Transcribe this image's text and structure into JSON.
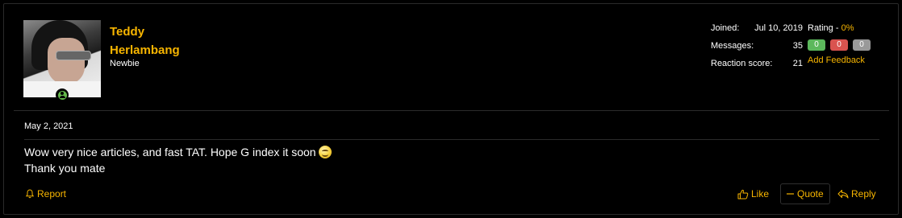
{
  "user": {
    "name": "Teddy Herlambang",
    "title": "Newbie"
  },
  "stats": {
    "joined_label": "Joined:",
    "joined_value": "Jul 10, 2019",
    "messages_label": "Messages:",
    "messages_value": "35",
    "reaction_label": "Reaction score:",
    "reaction_value": "21"
  },
  "rating": {
    "label": "Rating - ",
    "percent": "0%",
    "positive": "0",
    "negative": "0",
    "neutral": "0",
    "add_feedback": "Add Feedback"
  },
  "post": {
    "date": "May 2, 2021",
    "line1": "Wow very nice articles, and fast TAT. Hope G index it soon",
    "line2": "Thank you mate"
  },
  "actions": {
    "report": "Report",
    "like": "Like",
    "quote": "Quote",
    "reply": "Reply"
  },
  "colors": {
    "accent": "#f7b500",
    "background": "#000000",
    "positive": "#5cb85c",
    "negative": "#d9534f",
    "neutral": "#999999",
    "online": "#63b84a"
  },
  "icons": [
    "user-online-icon",
    "grinning-face-emoji",
    "bell-icon",
    "thumbs-up-icon",
    "quote-icon",
    "reply-icon"
  ]
}
